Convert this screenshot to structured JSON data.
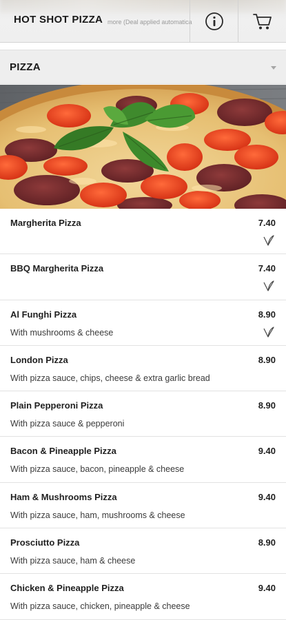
{
  "header": {
    "brand": "HOT SHOT PIZZA",
    "promo_text": "more (Deal applied automatica",
    "info_icon": "info-circle-icon",
    "cart_icon": "shopping-cart-icon"
  },
  "category": {
    "title": "PIZZA",
    "arrow_icon": "chevron-down-icon"
  },
  "hero": {
    "image": "pizza-photo"
  },
  "menu": {
    "items": [
      {
        "name": "Margherita Pizza",
        "price": "7.40",
        "description": "",
        "vegetarian": true
      },
      {
        "name": "BBQ Margherita Pizza",
        "price": "7.40",
        "description": "",
        "vegetarian": true
      },
      {
        "name": "Al Funghi Pizza",
        "price": "8.90",
        "description": "With mushrooms & cheese",
        "vegetarian": true
      },
      {
        "name": "London Pizza",
        "price": "8.90",
        "description": "With pizza sauce, chips, cheese & extra garlic bread",
        "vegetarian": false
      },
      {
        "name": "Plain Pepperoni Pizza",
        "price": "8.90",
        "description": "With pizza sauce & pepperoni",
        "vegetarian": false
      },
      {
        "name": "Bacon & Pineapple Pizza",
        "price": "9.40",
        "description": "With pizza sauce, bacon, pineapple & cheese",
        "vegetarian": false
      },
      {
        "name": "Ham & Mushrooms Pizza",
        "price": "9.40",
        "description": "With pizza sauce, ham, mushrooms & cheese",
        "vegetarian": false
      },
      {
        "name": "Prosciutto Pizza",
        "price": "8.90",
        "description": "With pizza sauce, ham & cheese",
        "vegetarian": false
      },
      {
        "name": "Chicken & Pineapple Pizza",
        "price": "9.40",
        "description": "With pizza sauce, chicken, pineapple & cheese",
        "vegetarian": false
      }
    ]
  }
}
